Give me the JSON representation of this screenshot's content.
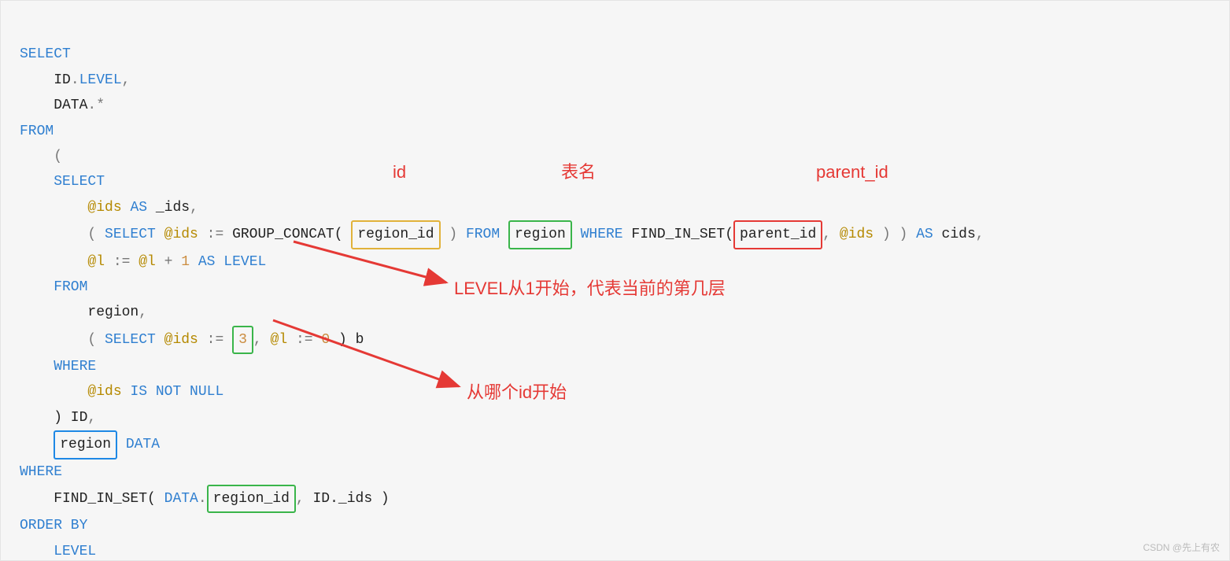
{
  "annotations": {
    "id_label": "id",
    "table_label": "表名",
    "parent_label": "parent_id",
    "level_note": "LEVEL从1开始，代表当前的第几层",
    "start_note": "从哪个id开始"
  },
  "code": {
    "l1_select": "SELECT",
    "l2_idlevel": "    ID",
    "l2_dot": ".",
    "l2_level": "LEVEL",
    "l2_comma": ",",
    "l3_data": "    DATA",
    "l3_dot": ".",
    "l3_star": "*",
    "l4_from": "FROM",
    "l5_paren": "    (",
    "l6_select": "    SELECT",
    "l7_var": "@ids",
    "l7_as": " AS",
    "l7_alias": " _ids",
    "l7_comma": ",",
    "l8_o": "        ( ",
    "l8_select": "SELECT",
    "l8_sp": " ",
    "l8_var": "@ids",
    "l8_assign": " :=",
    "l8_group": " GROUP_CONCAT( ",
    "l8_region_id": "region_id",
    "l8_close1": " )",
    "l8_from": " FROM",
    "l8_sp2": " ",
    "l8_region": "region",
    "l8_sp3": " ",
    "l8_where": "WHERE",
    "l8_find": " FIND_IN_SET(",
    "l8_parent": "parent_id",
    "l8_c": ",",
    "l8_sp4": " ",
    "l8_var2": "@ids",
    "l8_close2": " ) )",
    "l8_as": " AS",
    "l8_cids": " cids",
    "l8_comma": ",",
    "l9_sp": "        ",
    "l9_var": "@l",
    "l9_asg": " := ",
    "l9_var2": "@l",
    "l9_plus": " + ",
    "l9_one": "1",
    "l9_as": " AS",
    "l9_level": " LEVEL",
    "l10_from": "    FROM",
    "l11_region": "        region",
    "l11_c": ",",
    "l12_o": "        ( ",
    "l12_select": "SELECT",
    "l12_sp": " ",
    "l12_var": "@ids",
    "l12_asg": " :=",
    "l12_sp2": " ",
    "l12_three": "3",
    "l12_c": ",",
    "l12_sp3": " ",
    "l12_var2": "@l",
    "l12_asg2": " :=",
    "l12_sp4": " ",
    "l12_zero": "0",
    "l12_close": " ) b",
    "l13_where": "    WHERE",
    "l14_sp": "        ",
    "l14_var": "@ids",
    "l14_is": " IS NOT NULL",
    "l15_close": "    ) ID",
    "l15_c": ",",
    "l16_sp": "    ",
    "l16_region": "region",
    "l16_data": " DATA",
    "l17_where": "WHERE",
    "l18_find": "    FIND_IN_SET( ",
    "l18_data": "DATA",
    "l18_dot": ".",
    "l18_region_id": "region_id",
    "l18_c": ",",
    "l18_idids": " ID._ids )",
    "l19_order": "ORDER BY",
    "l20_level": "    LEVEL"
  },
  "watermark": "CSDN @先上有农"
}
